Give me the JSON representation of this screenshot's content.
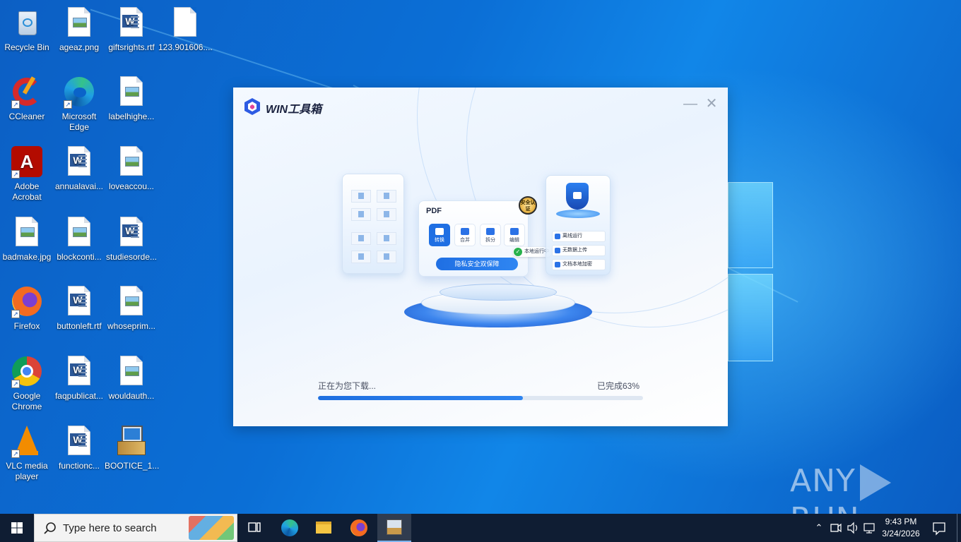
{
  "desktop": {
    "icons": [
      {
        "label": "Recycle Bin"
      },
      {
        "label": "ageaz.png"
      },
      {
        "label": "giftsrights.rtf"
      },
      {
        "label": "123.901606...."
      },
      {
        "label": "CCleaner"
      },
      {
        "label": "Microsoft Edge"
      },
      {
        "label": "labelhighe..."
      },
      {
        "label": "Adobe Acrobat"
      },
      {
        "label": "annualavai..."
      },
      {
        "label": "loveaccou..."
      },
      {
        "label": "badmake.jpg"
      },
      {
        "label": "blockconti..."
      },
      {
        "label": "studiesorde..."
      },
      {
        "label": "Firefox"
      },
      {
        "label": "buttonleft.rtf"
      },
      {
        "label": "whoseprim..."
      },
      {
        "label": "Google Chrome"
      },
      {
        "label": "faqpublicat..."
      },
      {
        "label": "wouldauth..."
      },
      {
        "label": "VLC media player"
      },
      {
        "label": "functionc..."
      },
      {
        "label": "BOOTICE_1..."
      }
    ],
    "watermark": {
      "left": "ANY",
      "right": "RUN"
    }
  },
  "dialog": {
    "title": "WIN工具箱",
    "minimize_symbol": "—",
    "close_symbol": "✕",
    "illustration": {
      "pdf_label": "PDF",
      "tools": [
        "转换",
        "合并",
        "拆分",
        "编辑"
      ],
      "guard_button": "隐私安全双保障",
      "badge": "安全认证",
      "local_tag": "本地运行中",
      "features": [
        "离线运行",
        "无数据上传",
        "文档本地加密"
      ]
    },
    "download_label": "正在为您下载...",
    "progress_text": "已完成63%",
    "progress_fraction": 0.63
  },
  "taskbar": {
    "search_placeholder": "Type here to search",
    "time": "9:43 PM",
    "date": "3/24/2026"
  },
  "colors": {
    "accent": "#1f6fe3",
    "taskbar": "#0f1d33",
    "wallpaper": "#0b6fd6"
  }
}
